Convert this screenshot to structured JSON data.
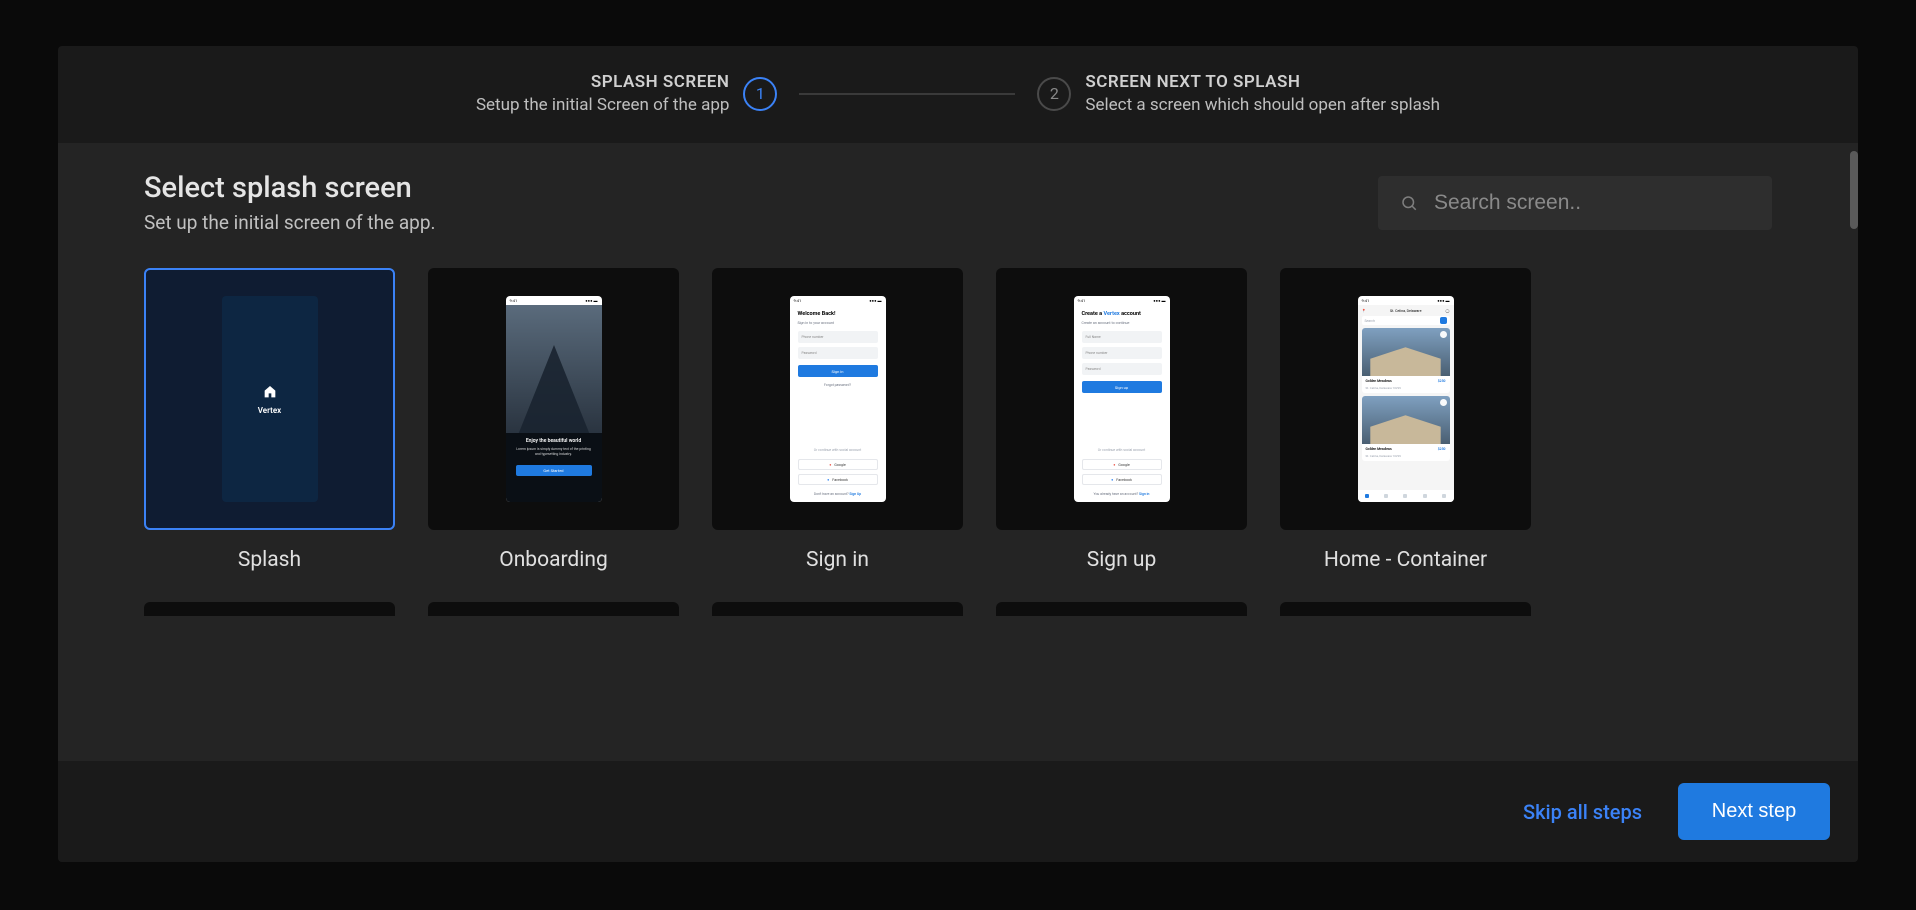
{
  "stepper": {
    "steps": [
      {
        "number": "1",
        "title": "SPLASH SCREEN",
        "desc": "Setup the initial Screen of the app",
        "active": true
      },
      {
        "number": "2",
        "title": "SCREEN NEXT TO SPLASH",
        "desc": "Select a screen which should open after splash",
        "active": false
      }
    ]
  },
  "content": {
    "heading": "Select splash screen",
    "subheading": "Set up the initial screen of the app."
  },
  "search": {
    "placeholder": "Search screen.."
  },
  "cards": [
    {
      "label": "Splash",
      "selected": true
    },
    {
      "label": "Onboarding",
      "selected": false
    },
    {
      "label": "Sign in",
      "selected": false
    },
    {
      "label": "Sign up",
      "selected": false
    },
    {
      "label": "Home - Container",
      "selected": false
    }
  ],
  "previews": {
    "splash_brand": "Vertex",
    "onboarding": {
      "title": "Enjoy the beautiful world",
      "desc": "Lorem ipsum is simply dummy text of the printing and typesetting industry.",
      "button": "Get Started"
    },
    "signin": {
      "title": "Welcome Back!",
      "sub": "Sign in to your account",
      "field1": "Phone number",
      "field2": "Password",
      "button": "Sign in",
      "forgot": "Forgot password?",
      "or": "Or continue with social account",
      "google": "Google",
      "facebook": "Facebook",
      "noaccount": "Don't have an account? ",
      "signup": "Sign Up"
    },
    "signup": {
      "title_pre": "Create a ",
      "title_accent": "Vertex",
      "title_post": " account",
      "sub": "Create an account to continue",
      "field0": "Full Name",
      "field1": "Phone number",
      "field2": "Password",
      "button": "Sign up",
      "or": "Or continue with social account",
      "google": "Google",
      "facebook": "Facebook",
      "haveaccount": "You already have an account? ",
      "signin": "Sign in"
    },
    "home": {
      "location": "St. Celina, Delaware",
      "search": "Search",
      "card_name": "Golden Meadows",
      "card_price": "$250",
      "card_loc": "St. Celina, Delaware 10299"
    },
    "phone_time": "9:41"
  },
  "footer": {
    "skip": "Skip all steps",
    "next": "Next step"
  }
}
